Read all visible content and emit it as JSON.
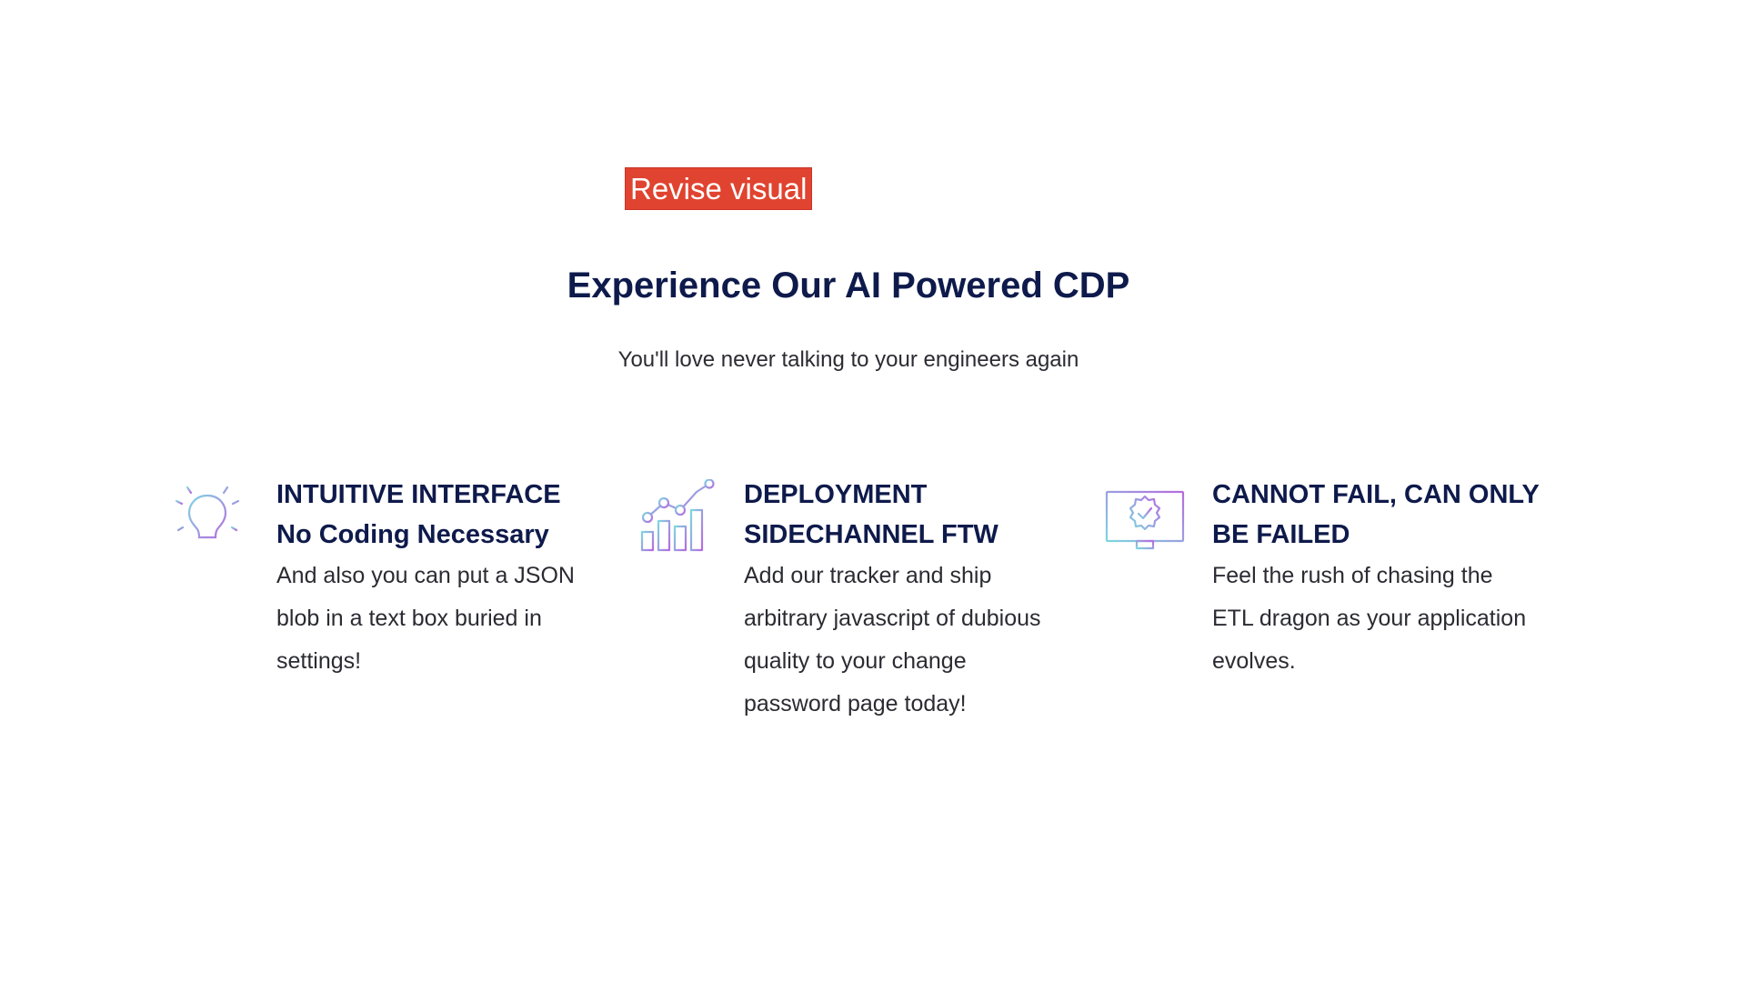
{
  "badge": {
    "label": "Revise visual"
  },
  "hero": {
    "title": "Experience Our AI Powered CDP",
    "subtitle": "You'll love never talking to your engineers again"
  },
  "features": [
    {
      "icon": "lightbulb-icon",
      "title": "INTUITIVE INTERFACE\nNo Coding Necessary",
      "description": "And also you can put a JSON\nblob in a text box buried in\nsettings!"
    },
    {
      "icon": "bar-chart-trend-icon",
      "title": "DEPLOYMENT\nSIDECHANNEL FTW",
      "description": "Add our tracker and ship\narbitrary javascript of dubious\nquality to your change\npassword page today!"
    },
    {
      "icon": "monitor-checkmark-icon",
      "title": "CANNOT FAIL, CAN ONLY\nBE FAILED",
      "description": "Feel the rush of chasing the\nETL dragon as your application\nevolves."
    }
  ],
  "colors": {
    "heading": "#0e1a4b",
    "body_text": "#2b2b33",
    "badge_bg": "#e0432f",
    "icon_gradient_start": "#7fd6e0",
    "icon_gradient_end": "#b66be0"
  }
}
